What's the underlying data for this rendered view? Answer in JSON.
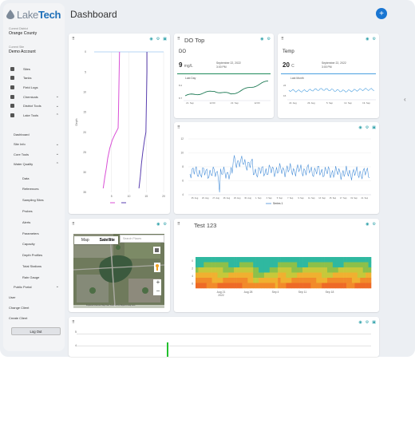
{
  "brand": {
    "logo_light": "Lake",
    "logo_bold": "Tech"
  },
  "context": {
    "district_label": "Current District",
    "district_value": "Orange County",
    "site_label": "Current Site",
    "site_value": "Demo Account"
  },
  "nav": {
    "items": [
      {
        "label": "Sites",
        "icon": "sites-icon"
      },
      {
        "label": "Tanks",
        "icon": "tanks-icon"
      },
      {
        "label": "Field Logs",
        "icon": "field-logs-icon"
      },
      {
        "label": "Chemicals",
        "icon": "chemicals-icon",
        "chevron": "⌄"
      },
      {
        "label": "District Tools",
        "icon": "district-tools-icon",
        "chevron": "⌄"
      },
      {
        "label": "Lake Tools",
        "icon": "lake-tools-icon",
        "chevron": "⌃"
      }
    ],
    "lake_sub": [
      {
        "label": "Dashboard"
      },
      {
        "label": "Site Info",
        "chevron": "⌄"
      },
      {
        "label": "Core Tools",
        "chevron": "⌄"
      },
      {
        "label": "Water Quality",
        "chevron": "⌃"
      }
    ],
    "wq_sub": [
      "Data",
      "References",
      "Sampling Sites",
      "Probes",
      "Alerts",
      "Parameters",
      "Capacity",
      "Depth Profiles",
      "Total Stations",
      "Rain Gauge"
    ],
    "bottom": [
      {
        "label": "Public Portal",
        "chevron": "⌄"
      },
      {
        "label": "User"
      },
      {
        "label": "Change Client"
      },
      {
        "label": "Create Client"
      }
    ],
    "logout": "Log Out"
  },
  "page": {
    "title": "Dashboard",
    "fab": "+"
  },
  "icons": {
    "drag": "⠿",
    "eye": "◉",
    "gear": "⚙",
    "camera": "▣",
    "chevron_right": "‹"
  },
  "do_card": {
    "title": "DO Top",
    "param": "DO",
    "value": "9",
    "unit": "mg/L",
    "date": "September 22, 2022",
    "time": "3:00 PM",
    "range": "Last Day",
    "y_ticks": [
      "8.2",
      "8.7"
    ],
    "x_ticks": [
      "21. Sep",
      "12:00",
      "22. Sep",
      "12:00"
    ],
    "accent": "#1e8a5a"
  },
  "temp_card": {
    "param": "Temp",
    "value": "20",
    "unit": "C",
    "date": "September 22, 2022",
    "time": "3:00 PM",
    "range": "Last Month",
    "y_ticks": [
      "24",
      "16"
    ],
    "x_ticks": [
      "22. Aug",
      "29. Aug",
      "5. Sep",
      "12. Sep",
      "19. Sep"
    ],
    "accent": "#4a9fe0"
  },
  "profile_card": {
    "y_ticks": [
      "0",
      "5",
      "10",
      "15",
      "20",
      "25",
      "30",
      "35"
    ],
    "x_ticks": [
      "5",
      "10",
      "15",
      "20"
    ],
    "ylabel": "Depth",
    "legend": [
      "",
      ""
    ],
    "colors": [
      "#d94fd6",
      "#5a3fb0"
    ]
  },
  "series_card": {
    "y_ticks": [
      "12",
      "10",
      "8",
      "6",
      "4"
    ],
    "x_ticks": [
      "25. Aug",
      "26. Aug",
      "27. Aug",
      "28. Aug",
      "29. Aug",
      "30. Aug",
      "1. Sep",
      "3. Sep",
      "5. Sep",
      "7. Sep",
      "9. Sep",
      "11. Sep",
      "13. Sep",
      "15. Sep",
      "17. Sep",
      "19. Sep",
      "21. Sep"
    ],
    "legend": "Series 1",
    "color": "#4a90d9"
  },
  "map_card": {
    "tab_map": "Map",
    "tab_satellite": "Satellite",
    "search_placeholder": "Search Places",
    "zoom_in": "+",
    "zoom_out": "−",
    "attribution": "Keyboard shortcuts  Map Data  Terms of Use  Report a map error"
  },
  "heatmap_card": {
    "title": "Test 123",
    "y_ticks": [
      "0",
      "2",
      "4",
      "6"
    ],
    "x_ticks": [
      "Aug 21\n2022",
      "Aug 28",
      "Sep 4",
      "Sep 11",
      "Sep 18"
    ]
  },
  "bottom_card": {
    "y_ticks": [
      "5",
      "4"
    ],
    "bar_color": "#22c02e"
  },
  "chart_data": [
    {
      "type": "line",
      "title": "",
      "x": [
        "21. Sep",
        "12:00",
        "22. Sep",
        "12:00"
      ],
      "series": [
        {
          "values": [
            8.6,
            8.2,
            8.3,
            8.5
          ]
        }
      ]
    },
    {
      "type": "line",
      "title": "",
      "x": [
        "22. Aug",
        "29. Aug",
        "5. Sep",
        "12. Sep",
        "19. Sep"
      ],
      "series": [
        {
          "values": [
            20,
            21,
            20,
            19,
            20
          ]
        }
      ]
    },
    {
      "type": "line",
      "title": "",
      "ylabel": "Depth",
      "ylim": [
        0,
        35
      ],
      "xlim": [
        0,
        20
      ],
      "series": [
        {
          "values": [
            [
              7,
              0
            ],
            [
              7,
              20
            ],
            [
              3,
              35
            ]
          ]
        },
        {
          "values": [
            [
              15,
              0
            ],
            [
              15,
              22
            ],
            [
              13,
              35
            ]
          ]
        }
      ]
    },
    {
      "type": "line",
      "title": "",
      "ylim": [
        3,
        13
      ],
      "series": [
        {
          "name": "Series 1",
          "values": [
            5,
            6,
            5,
            7,
            5,
            6,
            4,
            7,
            10,
            9,
            8,
            7,
            8,
            7,
            6,
            7,
            8,
            7,
            6,
            7,
            8,
            7,
            6,
            7,
            8,
            7,
            8,
            7,
            7,
            8
          ]
        }
      ]
    },
    {
      "type": "heatmap",
      "title": "Test 123",
      "ylim": [
        0,
        6
      ],
      "x": [
        "Aug 21",
        "Aug 28",
        "Sep 4",
        "Sep 11",
        "Sep 18"
      ]
    }
  ]
}
